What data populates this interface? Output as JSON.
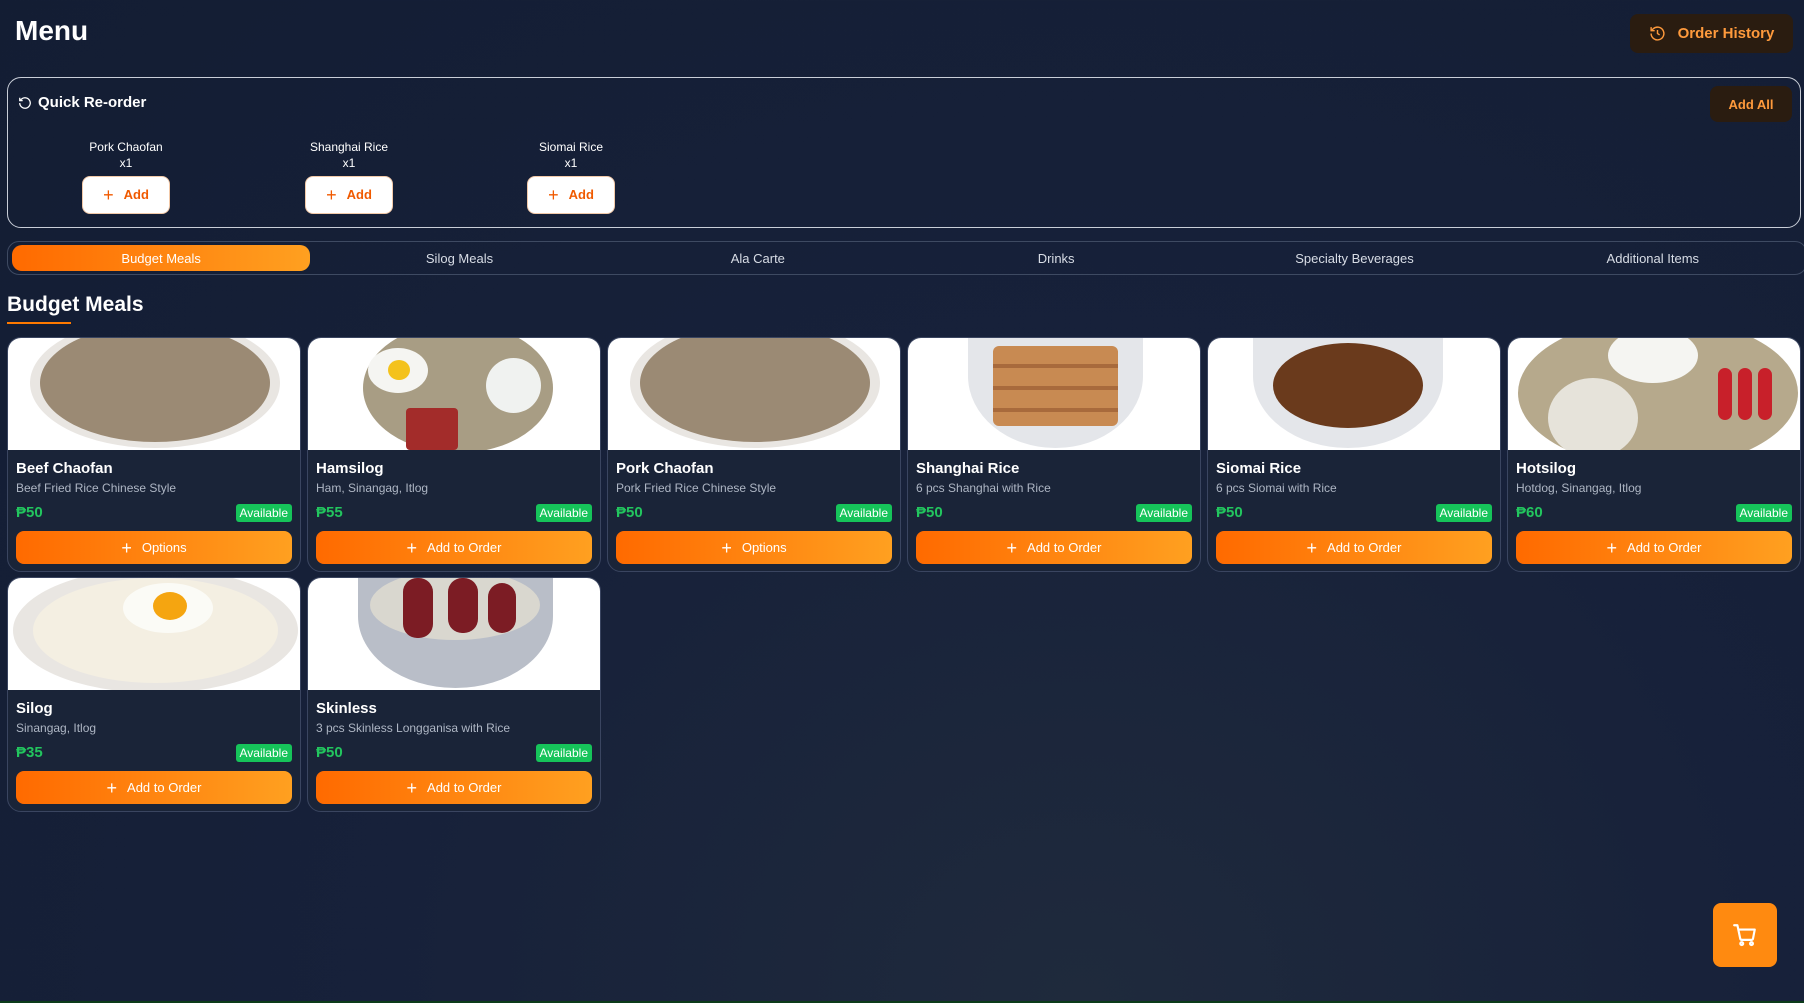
{
  "header": {
    "title": "Menu",
    "order_history_label": "Order History"
  },
  "quick_reorder": {
    "title": "Quick Re-order",
    "add_all_label": "Add All",
    "items": [
      {
        "name": "Pork Chaofan",
        "qty": "x1",
        "add_label": "Add"
      },
      {
        "name": "Shanghai Rice",
        "qty": "x1",
        "add_label": "Add"
      },
      {
        "name": "Siomai Rice",
        "qty": "x1",
        "add_label": "Add"
      }
    ]
  },
  "tabs": [
    "Budget Meals",
    "Silog Meals",
    "Ala Carte",
    "Drinks",
    "Specialty Beverages",
    "Additional Items"
  ],
  "active_tab": "Budget Meals",
  "section_title": "Budget Meals",
  "products": [
    {
      "name": "Beef Chaofan",
      "desc": "Beef Fried Rice Chinese Style",
      "price": "₱50",
      "status": "Available",
      "action": "Options"
    },
    {
      "name": "Hamsilog",
      "desc": "Ham, Sinangag, Itlog",
      "price": "₱55",
      "status": "Available",
      "action": "Add to Order"
    },
    {
      "name": "Pork Chaofan",
      "desc": "Pork Fried Rice Chinese Style",
      "price": "₱50",
      "status": "Available",
      "action": "Options"
    },
    {
      "name": "Shanghai Rice",
      "desc": "6 pcs Shanghai with Rice",
      "price": "₱50",
      "status": "Available",
      "action": "Add to Order"
    },
    {
      "name": "Siomai Rice",
      "desc": "6 pcs Siomai with Rice",
      "price": "₱50",
      "status": "Available",
      "action": "Add to Order"
    },
    {
      "name": "Hotsilog",
      "desc": "Hotdog, Sinangag, Itlog",
      "price": "₱60",
      "status": "Available",
      "action": "Add to Order"
    },
    {
      "name": "Silog",
      "desc": "Sinangag, Itlog",
      "price": "₱35",
      "status": "Available",
      "action": "Add to Order"
    },
    {
      "name": "Skinless",
      "desc": "3 pcs Skinless Longganisa with Rice",
      "price": "₱50",
      "status": "Available",
      "action": "Add to Order"
    }
  ],
  "colors": {
    "accent": "#ff7a00",
    "price": "#22c55e",
    "badge": "#16c45a",
    "background": "#17213a"
  }
}
